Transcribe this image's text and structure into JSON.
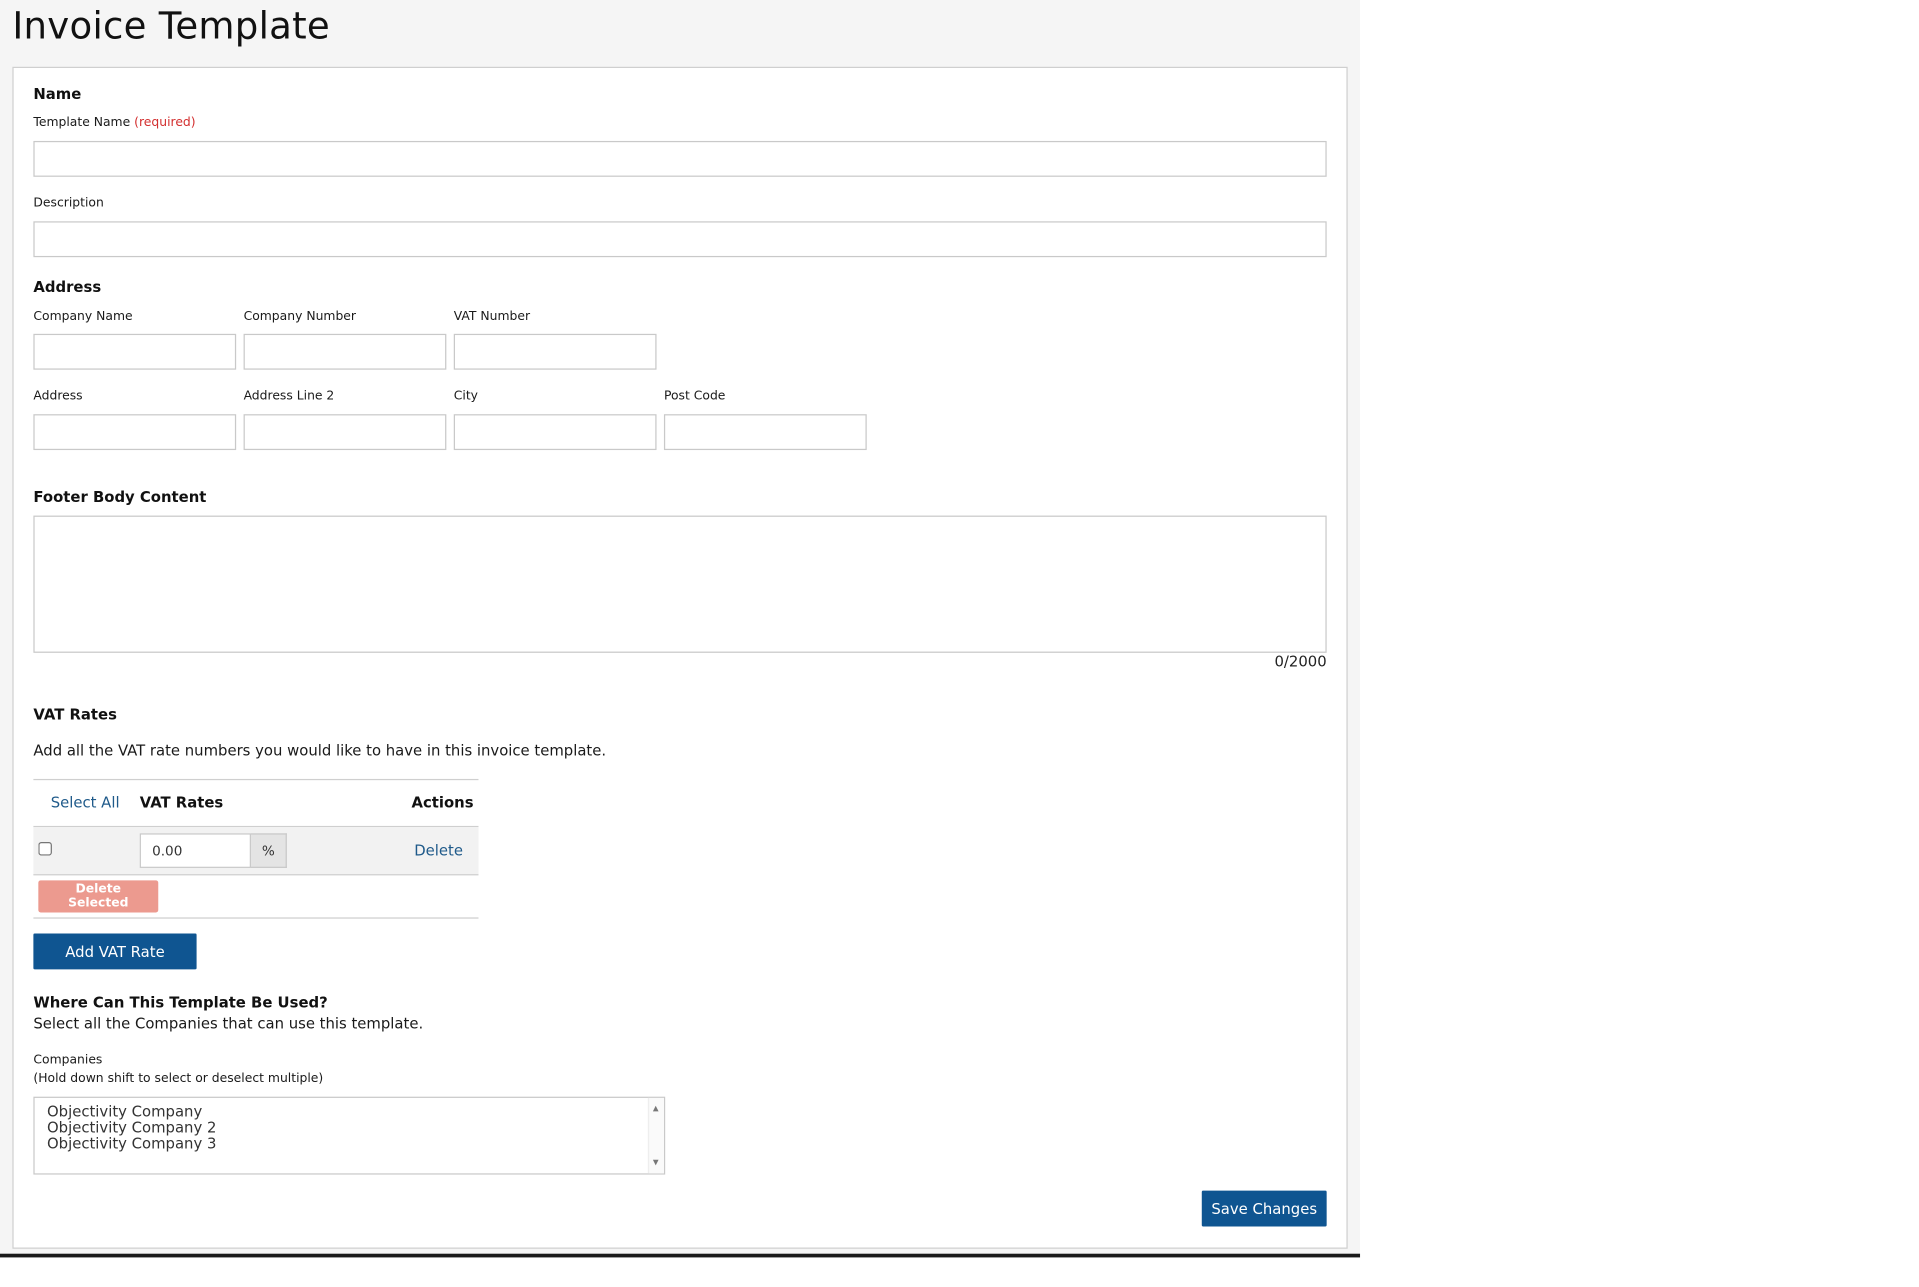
{
  "page": {
    "title": "Invoice Template"
  },
  "name_section": {
    "heading": "Name",
    "template_name_label": "Template Name",
    "required_text": "(required)",
    "template_name_value": "",
    "description_label": "Description",
    "description_value": ""
  },
  "address_section": {
    "heading": "Address",
    "company_name_label": "Company Name",
    "company_number_label": "Company Number",
    "vat_number_label": "VAT Number",
    "address_label": "Address",
    "address_line2_label": "Address Line 2",
    "city_label": "City",
    "post_code_label": "Post Code"
  },
  "footer_section": {
    "heading": "Footer Body Content",
    "value": "",
    "counter": "0/2000"
  },
  "vat_section": {
    "heading": "VAT Rates",
    "intro": "Add all the VAT rate numbers you would like to have in this invoice template.",
    "col_select_all": "Select All",
    "col_vat_rates": "VAT Rates",
    "col_actions": "Actions",
    "rows": [
      {
        "value": "0.00",
        "unit": "%",
        "action": "Delete",
        "checked": false
      }
    ],
    "delete_selected_label": "Delete Selected",
    "add_label": "Add VAT Rate"
  },
  "usage_section": {
    "heading": "Where Can This Template Be Used?",
    "intro": "Select all the Companies that can use this template.",
    "companies_label": "Companies",
    "companies_hint": "(Hold down shift to select or deselect multiple)",
    "companies": [
      "Objectivity Company",
      "Objectivity Company 2",
      "Objectivity Company 3"
    ]
  },
  "actions": {
    "save_label": "Save Changes"
  },
  "colors": {
    "primary": "#0f5591",
    "danger_disabled": "#ec9a8f",
    "required": "#d32f2f",
    "link": "#1f5a8a"
  }
}
